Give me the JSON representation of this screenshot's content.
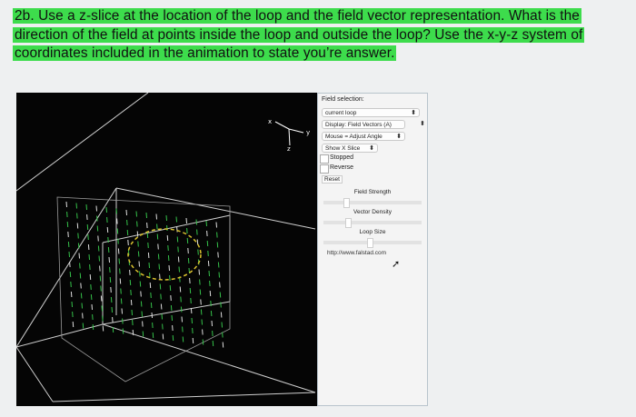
{
  "question": {
    "line1": "2b. Use a z-slice at the location of the loop and the field vector representation. What is the",
    "line2": "direction of the field at points inside the loop and outside the loop? Use the x-y-z system of",
    "line3": "coordinates included in the animation to state you’re answer."
  },
  "axes": {
    "x": "x",
    "y": "y",
    "z": "z"
  },
  "panel": {
    "field_selection_label": "Field selection:",
    "field_selection_value": "current loop",
    "display_value": "Display: Field Vectors (A)",
    "mouse_value": "Mouse = Adjust Angle",
    "slice_value": "Show X Slice",
    "stopped_label": "Stopped",
    "reverse_label": "Reverse",
    "reset_label": "Reset",
    "field_strength_label": "Field Strength",
    "vector_density_label": "Vector Density",
    "loop_size_label": "Loop Size",
    "link_text": "http://www.falstad.com"
  },
  "colors": {
    "highlight": "#3ddc4c",
    "vector": "#35c24a",
    "loop": "#d9c12e"
  }
}
